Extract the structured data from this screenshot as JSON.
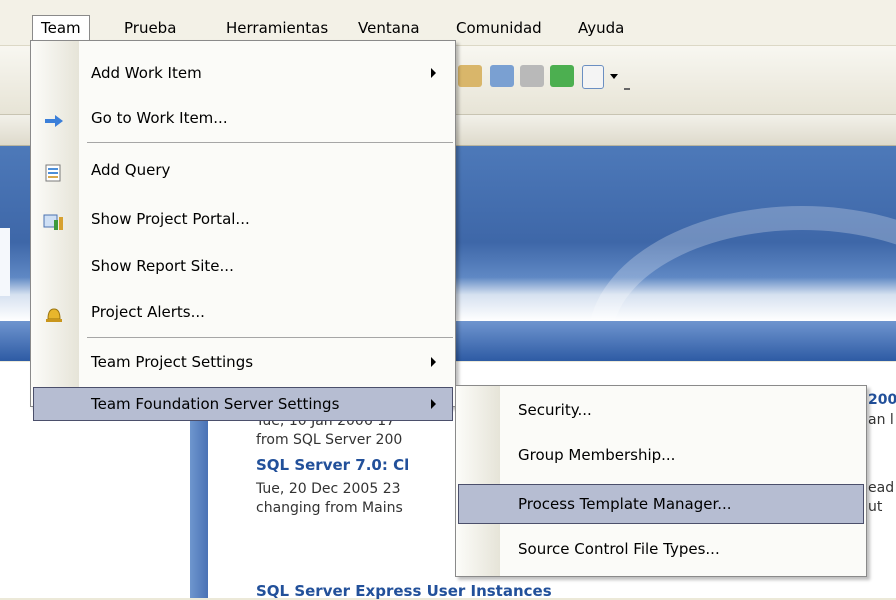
{
  "menubar": {
    "items": [
      "Team",
      "Prueba",
      "Herramientas",
      "Ventana",
      "Comunidad",
      "Ayuda"
    ]
  },
  "team_menu": {
    "items": [
      {
        "label": "Add Work Item",
        "has_submenu": true
      },
      {
        "label": "Go to Work Item...",
        "icon": "arrow-right-icon"
      },
      {
        "label": "Add Query",
        "icon": "query-icon"
      },
      {
        "label": "Show Project Portal...",
        "icon": "portal-icon"
      },
      {
        "label": "Show Report Site..."
      },
      {
        "label": "Project Alerts...",
        "icon": "bell-icon"
      },
      {
        "label": "Team Project Settings",
        "has_submenu": true
      },
      {
        "label": "Team Foundation Server Settings",
        "has_submenu": true,
        "highlighted": true
      }
    ]
  },
  "submenu": {
    "items": [
      {
        "label": "Security..."
      },
      {
        "label": "Group Membership..."
      },
      {
        "label": "Process Template Manager...",
        "highlighted": true
      },
      {
        "label": "Source Control File Types..."
      }
    ]
  },
  "news": {
    "items": [
      {
        "line1": "Tue, 10 Jan 2006 17",
        "line2": "from SQL Server 200"
      },
      {
        "title": "SQL Server 7.0: Cl",
        "line1": "Tue, 20 Dec 2005 23",
        "line2": "changing from Mains"
      },
      {
        "title": "SQL Server Express User Instances"
      }
    ],
    "right_fragments": [
      "200",
      "an l",
      "ead",
      "ut"
    ]
  },
  "colors": {
    "highlight": "#b6bdd2",
    "banner_blue": "#3e67a8",
    "news_title": "#22509a"
  }
}
